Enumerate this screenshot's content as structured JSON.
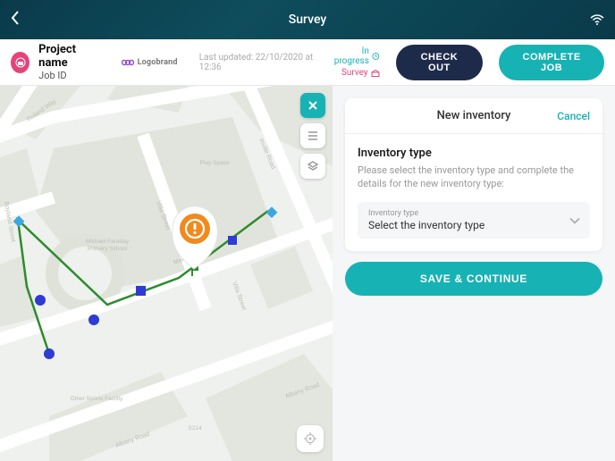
{
  "topbar": {
    "title": "Survey"
  },
  "info": {
    "project_name": "Project name",
    "job_id": "Job ID",
    "brand_label": "Logobrand",
    "last_updated": "Last updated: 22/10/2020 at 12:36",
    "status_inprogress": "In progress",
    "status_survey": "Survey",
    "checkout_label": "CHECK OUT",
    "complete_label": "COMPLETE JOB"
  },
  "map": {
    "streets": [
      "Roland Way",
      "Boyland Street",
      "Villa Street",
      "Inville Road",
      "Albany Road"
    ],
    "labels": {
      "play_space": "Play Space",
      "school": "Michael Faraday\nPrimary School",
      "sports": "Other Sports Facility",
      "area_code": "S214"
    }
  },
  "panel": {
    "title": "New inventory",
    "cancel": "Cancel",
    "section_title": "Inventory type",
    "section_desc": "Please select the inventory type and complete the details for the new inventory type:",
    "select_label": "Inventory type",
    "select_value": "Select the inventory type",
    "save_label": "SAVE & CONTINUE"
  }
}
